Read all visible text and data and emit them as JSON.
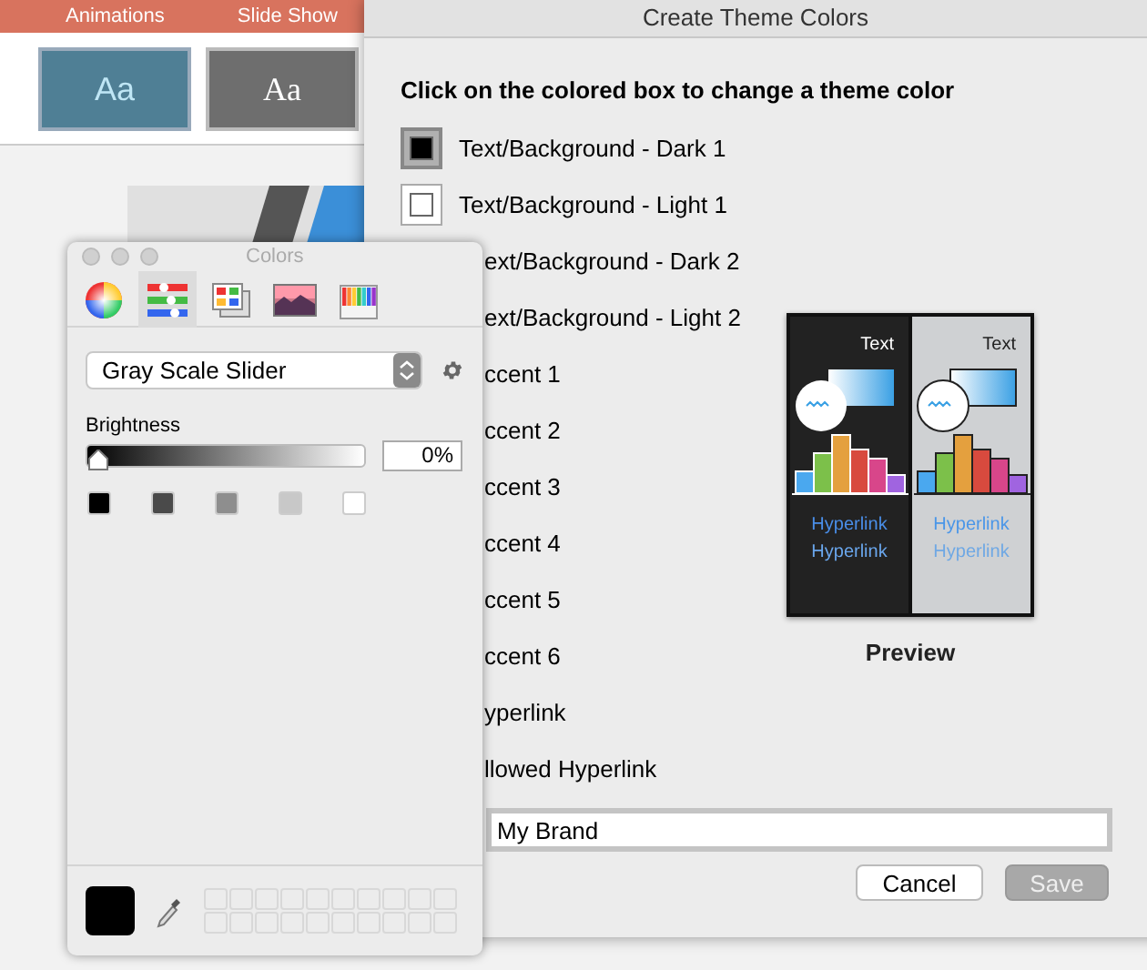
{
  "background_app": {
    "ribbon_tabs": [
      "Animations",
      "Slide Show"
    ],
    "theme_thumbnails": [
      {
        "label": "Aa",
        "kind": "blue",
        "selected": true
      },
      {
        "label": "Aa",
        "kind": "gray",
        "selected": false
      }
    ]
  },
  "dialog": {
    "title": "Create Theme Colors",
    "instruction": "Click on the colored box to change a theme color",
    "theme_colors": [
      {
        "label": "Text/Background - Dark 1",
        "color": "#000000",
        "selected": true
      },
      {
        "label": "Text/Background - Light 1",
        "color": "#ffffff",
        "selected": false
      },
      {
        "label": "ext/Background - Dark 2"
      },
      {
        "label": "ext/Background - Light 2"
      },
      {
        "label": "ccent 1"
      },
      {
        "label": "ccent 2"
      },
      {
        "label": "ccent 3"
      },
      {
        "label": "ccent 4"
      },
      {
        "label": "ccent 5"
      },
      {
        "label": "ccent 6"
      },
      {
        "label": "yperlink"
      },
      {
        "label": "llowed Hyperlink"
      }
    ],
    "preview": {
      "panels": [
        {
          "kind": "dark",
          "text": "Text",
          "hyperlinks": [
            "Hyperlink",
            "Hyperlink"
          ]
        },
        {
          "kind": "light",
          "text": "Text",
          "hyperlinks": [
            "Hyperlink",
            "Hyperlink"
          ]
        }
      ],
      "label": "Preview"
    },
    "name_field": {
      "value": "My Brand"
    },
    "buttons": [
      {
        "label": "Cancel",
        "disabled": false
      },
      {
        "label": "Save",
        "disabled": true
      }
    ]
  },
  "colors_panel": {
    "title": "Colors",
    "tabs": [
      {
        "kind": "wheel",
        "selected": false
      },
      {
        "kind": "sliders",
        "selected": true
      },
      {
        "kind": "palettes",
        "selected": false
      },
      {
        "kind": "image",
        "selected": false
      },
      {
        "kind": "pencils",
        "selected": false
      }
    ],
    "mode": "Gray Scale Slider",
    "slider_label": "Brightness",
    "level": 0,
    "reading": "0%",
    "presets": [
      {
        "color": "#000000"
      },
      {
        "color": "#4a4a4a"
      },
      {
        "color": "#8e8e8e"
      },
      {
        "color": "#c8c8c8"
      },
      {
        "color": "#ffffff"
      }
    ],
    "current": {
      "color": "#000000"
    }
  }
}
